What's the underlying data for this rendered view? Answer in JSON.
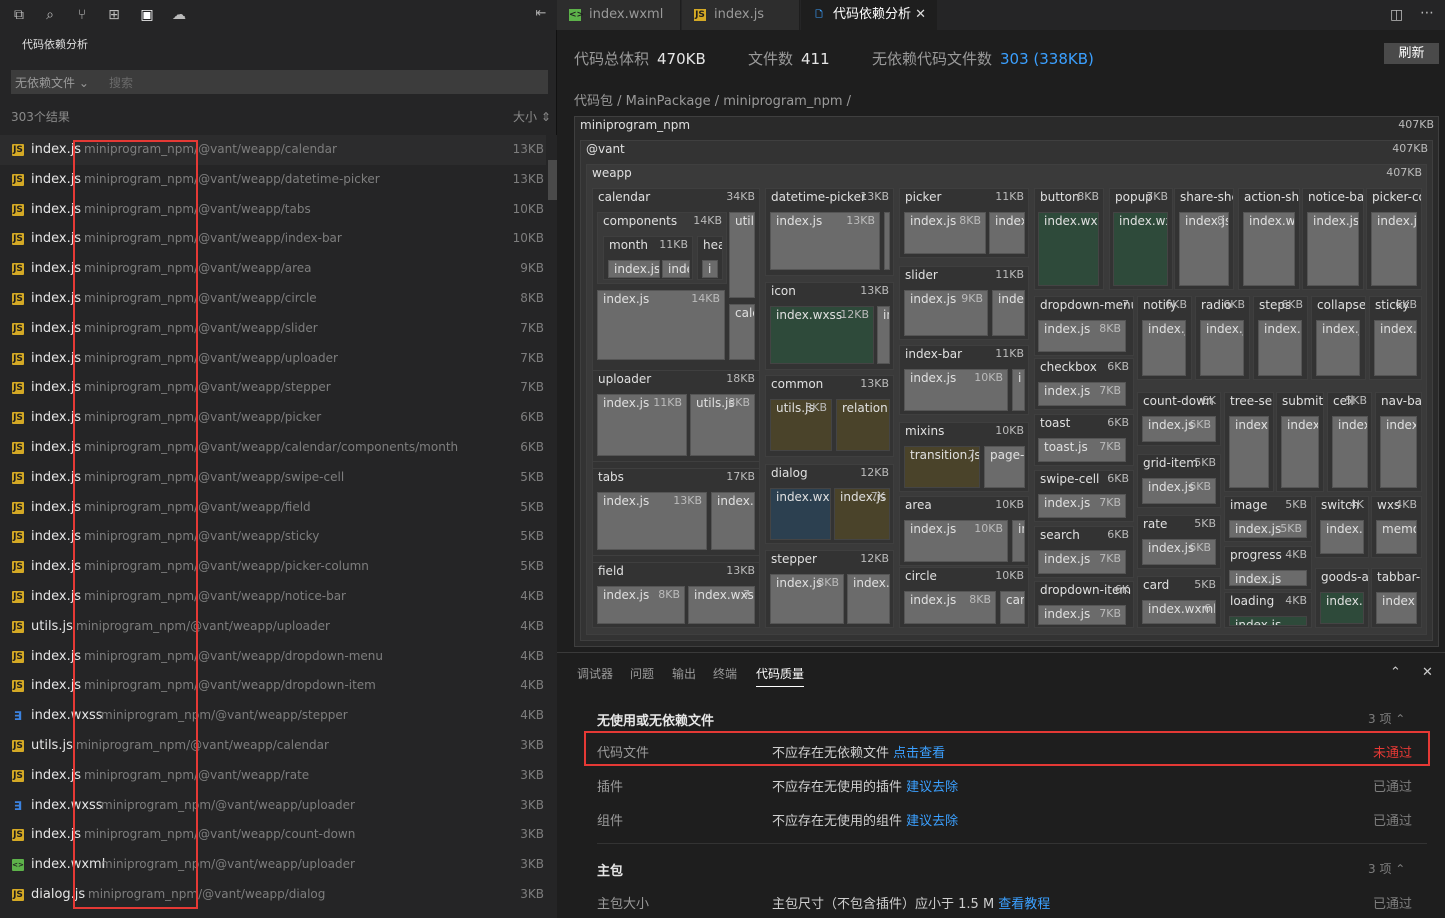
{
  "activity": {
    "icons": [
      "files-icon",
      "search-icon",
      "source-control-icon",
      "extensions-icon",
      "save-icon",
      "cloud-icon"
    ]
  },
  "panel": {
    "title": "代码依赖分析",
    "filter": "无依赖文件",
    "search_placeholder": "搜索",
    "result_count": "303个结果",
    "sort_label": "大小"
  },
  "files": [
    {
      "name": "index.js",
      "type": "js",
      "path": "miniprogram_npm/@vant/weapp/calendar",
      "size": "13KB"
    },
    {
      "name": "index.js",
      "type": "js",
      "path": "miniprogram_npm/@vant/weapp/datetime-picker",
      "size": "13KB"
    },
    {
      "name": "index.js",
      "type": "js",
      "path": "miniprogram_npm/@vant/weapp/tabs",
      "size": "10KB"
    },
    {
      "name": "index.js",
      "type": "js",
      "path": "miniprogram_npm/@vant/weapp/index-bar",
      "size": "10KB"
    },
    {
      "name": "index.js",
      "type": "js",
      "path": "miniprogram_npm/@vant/weapp/area",
      "size": "9KB"
    },
    {
      "name": "index.js",
      "type": "js",
      "path": "miniprogram_npm/@vant/weapp/circle",
      "size": "8KB"
    },
    {
      "name": "index.js",
      "type": "js",
      "path": "miniprogram_npm/@vant/weapp/slider",
      "size": "7KB"
    },
    {
      "name": "index.js",
      "type": "js",
      "path": "miniprogram_npm/@vant/weapp/uploader",
      "size": "7KB"
    },
    {
      "name": "index.js",
      "type": "js",
      "path": "miniprogram_npm/@vant/weapp/stepper",
      "size": "7KB"
    },
    {
      "name": "index.js",
      "type": "js",
      "path": "miniprogram_npm/@vant/weapp/picker",
      "size": "6KB"
    },
    {
      "name": "index.js",
      "type": "js",
      "path": "miniprogram_npm/@vant/weapp/calendar/components/month",
      "size": "6KB"
    },
    {
      "name": "index.js",
      "type": "js",
      "path": "miniprogram_npm/@vant/weapp/swipe-cell",
      "size": "5KB"
    },
    {
      "name": "index.js",
      "type": "js",
      "path": "miniprogram_npm/@vant/weapp/field",
      "size": "5KB"
    },
    {
      "name": "index.js",
      "type": "js",
      "path": "miniprogram_npm/@vant/weapp/sticky",
      "size": "5KB"
    },
    {
      "name": "index.js",
      "type": "js",
      "path": "miniprogram_npm/@vant/weapp/picker-column",
      "size": "5KB"
    },
    {
      "name": "index.js",
      "type": "js",
      "path": "miniprogram_npm/@vant/weapp/notice-bar",
      "size": "4KB"
    },
    {
      "name": "utils.js",
      "type": "js",
      "path": "miniprogram_npm/@vant/weapp/uploader",
      "size": "4KB"
    },
    {
      "name": "index.js",
      "type": "js",
      "path": "miniprogram_npm/@vant/weapp/dropdown-menu",
      "size": "4KB"
    },
    {
      "name": "index.js",
      "type": "js",
      "path": "miniprogram_npm/@vant/weapp/dropdown-item",
      "size": "4KB"
    },
    {
      "name": "index.wxss",
      "type": "wxss",
      "path": "miniprogram_npm/@vant/weapp/stepper",
      "size": "4KB"
    },
    {
      "name": "utils.js",
      "type": "js",
      "path": "miniprogram_npm/@vant/weapp/calendar",
      "size": "3KB"
    },
    {
      "name": "index.js",
      "type": "js",
      "path": "miniprogram_npm/@vant/weapp/rate",
      "size": "3KB"
    },
    {
      "name": "index.wxss",
      "type": "wxss",
      "path": "miniprogram_npm/@vant/weapp/uploader",
      "size": "3KB"
    },
    {
      "name": "index.js",
      "type": "js",
      "path": "miniprogram_npm/@vant/weapp/count-down",
      "size": "3KB"
    },
    {
      "name": "index.wxml",
      "type": "wxml",
      "path": "miniprogram_npm/@vant/weapp/uploader",
      "size": "3KB"
    },
    {
      "name": "dialog.js",
      "type": "js",
      "path": "miniprogram_npm/@vant/weapp/dialog",
      "size": "3KB"
    }
  ],
  "tabs": [
    {
      "label": "index.wxml",
      "icon": "wxml"
    },
    {
      "label": "index.js",
      "icon": "js"
    },
    {
      "label": "代码依赖分析",
      "icon": "doc"
    }
  ],
  "stats": {
    "total_label": "代码总体积",
    "total_value": "470KB",
    "files_label": "文件数",
    "files_value": "411",
    "nodep_label": "无依赖代码文件数",
    "nodep_value": "303 (338KB)",
    "refresh_label": "刷新"
  },
  "breadcrumb": "代码包 / MainPackage / miniprogram_npm /",
  "treemap": {
    "root": {
      "label": "miniprogram_npm",
      "size": "407KB"
    },
    "vant": {
      "label": "@vant",
      "size": "407KB"
    },
    "weapp": {
      "label": "weapp",
      "size": "407KB"
    }
  },
  "bottom": {
    "tabs": [
      "调试器",
      "问题",
      "输出",
      "终端",
      "代码质量"
    ],
    "sec1": {
      "title": "无使用或无依赖文件",
      "count": "3 项"
    },
    "rows1": [
      {
        "name": "代码文件",
        "desc": "不应存在无依赖文件",
        "link": "点击查看",
        "status": "未通过",
        "fail": true
      },
      {
        "name": "插件",
        "desc": "不应存在无使用的插件",
        "link": "建议去除",
        "status": "已通过",
        "fail": false
      },
      {
        "name": "组件",
        "desc": "不应存在无使用的组件",
        "link": "建议去除",
        "status": "已通过",
        "fail": false
      }
    ],
    "sec2": {
      "title": "主包",
      "count": "3 项"
    },
    "rows2": [
      {
        "name": "主包大小",
        "desc": "主包尺寸（不包含插件）应小于 1.5 M",
        "link": "查看教程",
        "status": "已通过",
        "fail": false
      }
    ]
  }
}
